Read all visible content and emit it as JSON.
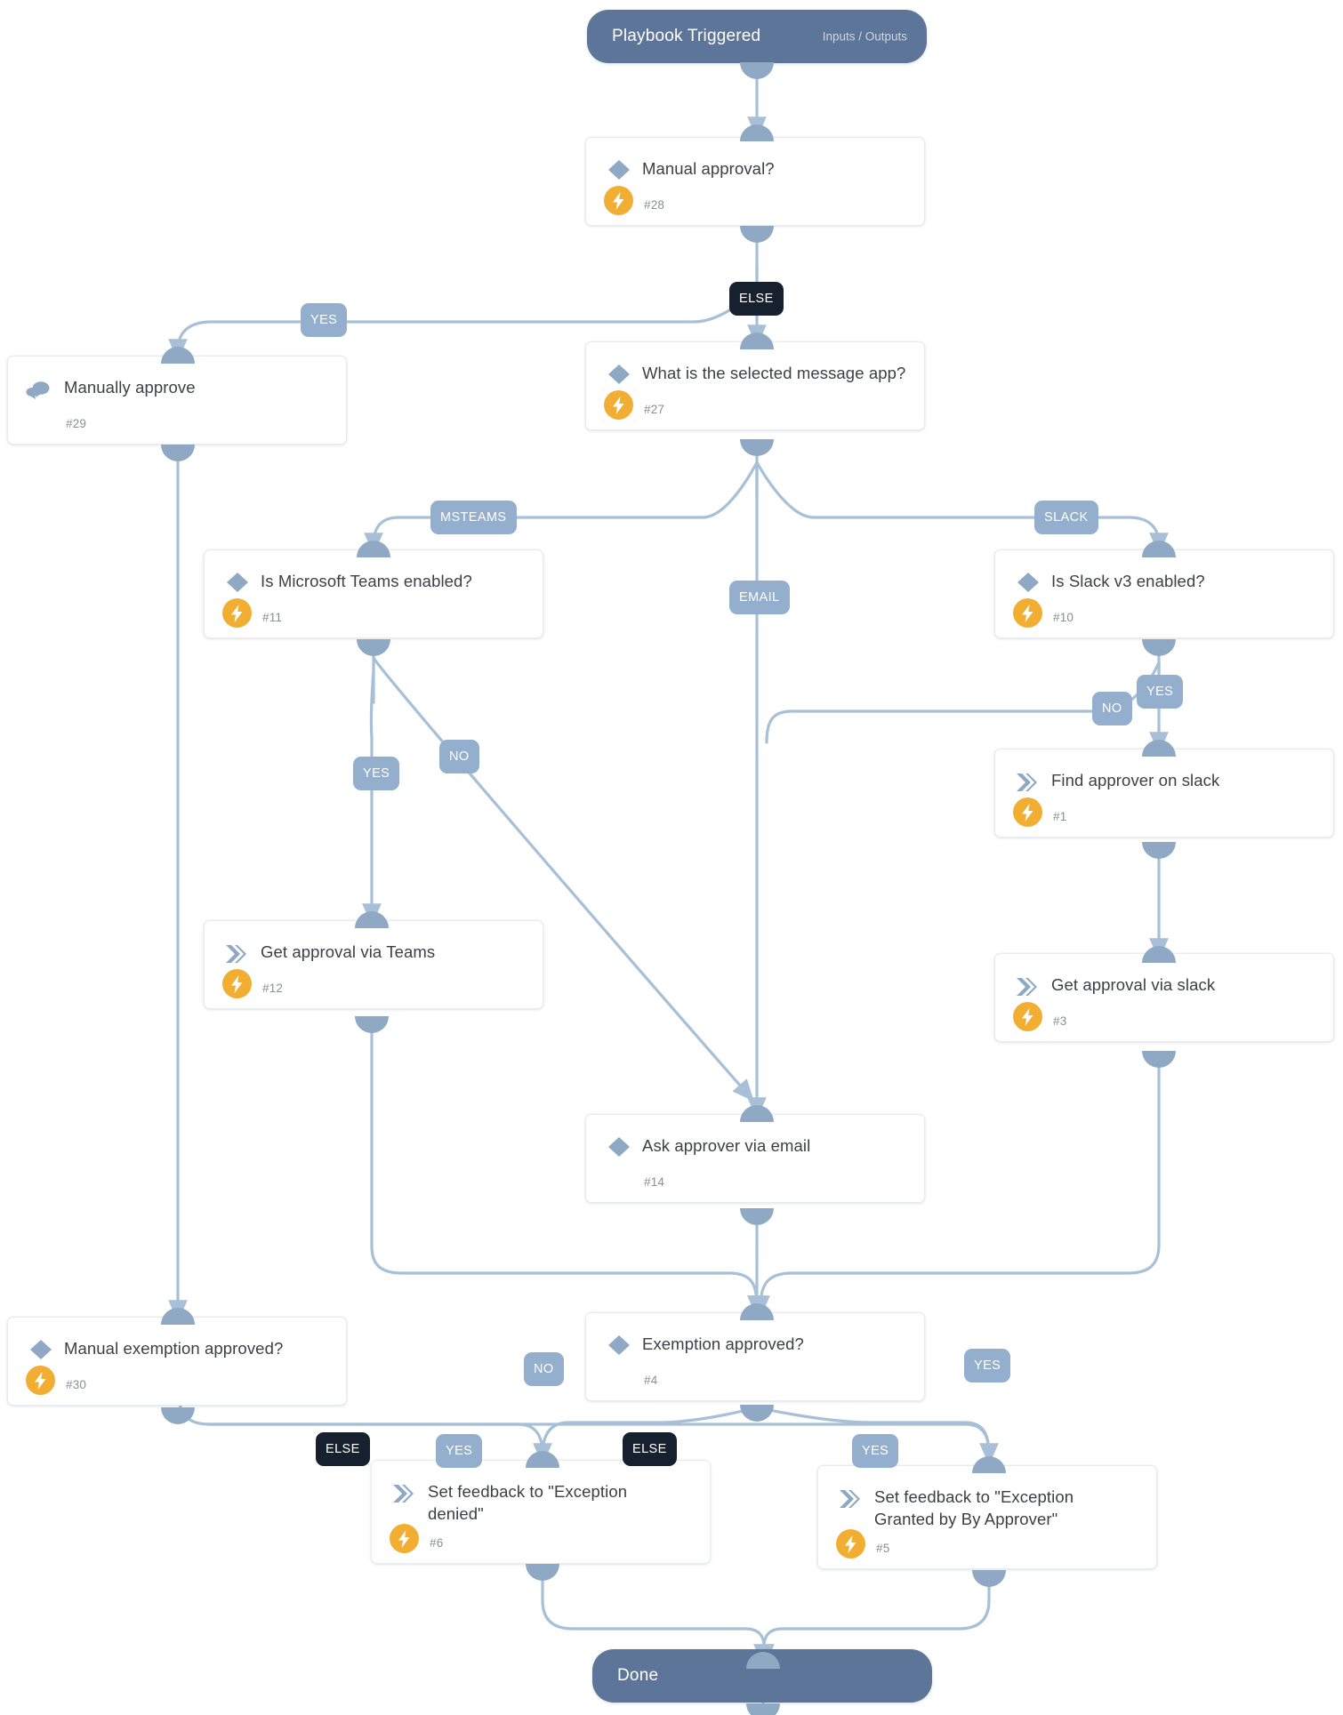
{
  "diagram": {
    "type": "playbook-flowchart",
    "background": "#ffffff",
    "colors": {
      "terminal": "#5d7599",
      "edge": "#a7c0d7",
      "badge_light": "#93afcd",
      "badge_dark": "#16202e",
      "bolt": "#f2ae32",
      "node_text": "#3c3f44",
      "node_number": "#8a8f96"
    }
  },
  "trigger": {
    "label": "Playbook Triggered",
    "sub": "Inputs / Outputs"
  },
  "end": {
    "label": "Done"
  },
  "nodes": [
    {
      "id": "n28",
      "title": "Manual approval?",
      "num": "#28",
      "icon": "diamond-icon",
      "bolt": true
    },
    {
      "id": "n29",
      "title": "Manually approve",
      "num": "#29",
      "icon": "chat-bubble-icon",
      "bolt": false
    },
    {
      "id": "n27",
      "title": "What is the selected message app?",
      "num": "#27",
      "icon": "diamond-icon",
      "bolt": true
    },
    {
      "id": "n11",
      "title": "Is Microsoft Teams enabled?",
      "num": "#11",
      "icon": "diamond-icon",
      "bolt": true
    },
    {
      "id": "n10",
      "title": "Is Slack v3 enabled?",
      "num": "#10",
      "icon": "diamond-icon",
      "bolt": true
    },
    {
      "id": "n1",
      "title": "Find approver on slack",
      "num": "#1",
      "icon": "chevron-icon",
      "bolt": true
    },
    {
      "id": "n12",
      "title": "Get approval via Teams",
      "num": "#12",
      "icon": "chevron-icon",
      "bolt": true
    },
    {
      "id": "n3",
      "title": "Get approval via slack",
      "num": "#3",
      "icon": "chevron-icon",
      "bolt": true
    },
    {
      "id": "n14",
      "title": "Ask approver via email",
      "num": "#14",
      "icon": "diamond-icon",
      "bolt": false
    },
    {
      "id": "n30",
      "title": "Manual exemption approved?",
      "num": "#30",
      "icon": "diamond-icon",
      "bolt": true
    },
    {
      "id": "n4",
      "title": "Exemption approved?",
      "num": "#4",
      "icon": "diamond-icon",
      "bolt": false
    },
    {
      "id": "n6",
      "title": "Set feedback to \"Exception denied\"",
      "num": "#6",
      "icon": "chevron-icon",
      "bolt": true
    },
    {
      "id": "n5",
      "title": "Set feedback to \"Exception Granted by By Approver\"",
      "num": "#5",
      "icon": "chevron-icon",
      "bolt": true
    }
  ],
  "edge_labels": [
    {
      "id": "e_yes_manual",
      "text": "YES",
      "style": "light"
    },
    {
      "id": "e_else_manual",
      "text": "ELSE",
      "style": "dark"
    },
    {
      "id": "e_msteams",
      "text": "MSTEAMS",
      "style": "light"
    },
    {
      "id": "e_email",
      "text": "EMAIL",
      "style": "light"
    },
    {
      "id": "e_slack",
      "text": "SLACK",
      "style": "light"
    },
    {
      "id": "e_teams_yes",
      "text": "YES",
      "style": "light"
    },
    {
      "id": "e_teams_no",
      "text": "NO",
      "style": "light"
    },
    {
      "id": "e_slack_no",
      "text": "NO",
      "style": "light"
    },
    {
      "id": "e_slack_yes",
      "text": "YES",
      "style": "light"
    },
    {
      "id": "e_ex_no",
      "text": "NO",
      "style": "light"
    },
    {
      "id": "e_ex_yes_right",
      "text": "YES",
      "style": "light"
    },
    {
      "id": "e_manual_else",
      "text": "ELSE",
      "style": "dark"
    },
    {
      "id": "e_manual_yes",
      "text": "YES",
      "style": "light"
    },
    {
      "id": "e_ex_else",
      "text": "ELSE",
      "style": "dark"
    },
    {
      "id": "e_ex_yes_bottom",
      "text": "YES",
      "style": "light"
    }
  ]
}
